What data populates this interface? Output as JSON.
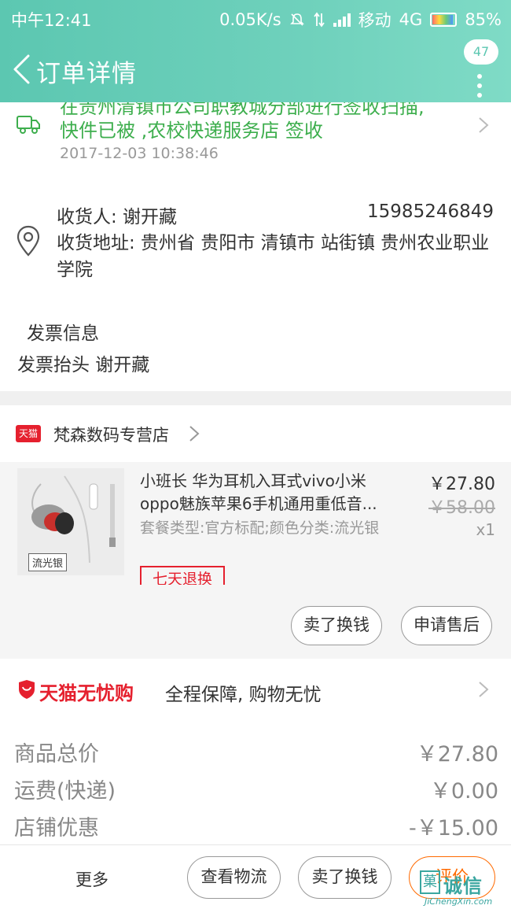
{
  "status_bar": {
    "time": "中午12:41",
    "net_speed": "0.05K/s",
    "carrier": "移动",
    "network": "4G",
    "battery": "85%",
    "battery_level": 0.85
  },
  "header": {
    "title": "订单详情",
    "badge_count": "47"
  },
  "logistics": {
    "line1": "在贵州清镇市公司职教城分部进行签收扫描,",
    "line2": "快件已被 ,农校快递服务店 签收",
    "time": "2017-12-03 10:38:46"
  },
  "address": {
    "receiver": "收货人: 谢开藏",
    "phone": "15985246849",
    "address": "收货地址: 贵州省 贵阳市 清镇市 站街镇 贵州农业职业学院"
  },
  "invoice": {
    "title": "发票信息",
    "line": "发票抬头 谢开藏"
  },
  "store": {
    "badge": "天猫",
    "name": "梵森数码专营店"
  },
  "item": {
    "title_line1": "小班长 华为耳机入耳式vivo小米",
    "title_line2": "oppo魅族苹果6手机通用重低音...",
    "sku": "套餐类型:官方标配;颜色分类:流光银",
    "tag": "七天退换",
    "price": "￥27.80",
    "original_price": "￥58.00",
    "quantity": "x1",
    "thumb_label": "流光银",
    "resell_label": "卖了换钱",
    "after_sale_label": "申请售后"
  },
  "guarantee": {
    "brand": "天猫无忧购",
    "text": "全程保障, 购物无忧"
  },
  "summary": [
    {
      "label": "商品总价",
      "value": "￥27.80"
    },
    {
      "label": "运费(快递)",
      "value": "￥0.00"
    },
    {
      "label": "店铺优惠",
      "value": "-￥15.00"
    }
  ],
  "bottom_bar": {
    "more": "更多",
    "view_logistics": "查看物流",
    "resell": "卖了换钱",
    "review": "评价"
  },
  "watermark": {
    "box": "菓",
    "text": "诚信",
    "url": "JiChengXin.com"
  },
  "colors": {
    "accent": "#5cc7b1",
    "logistics_green": "#3dae4d",
    "tmall_red": "#e5202e",
    "review_orange": "#ff6a00"
  }
}
